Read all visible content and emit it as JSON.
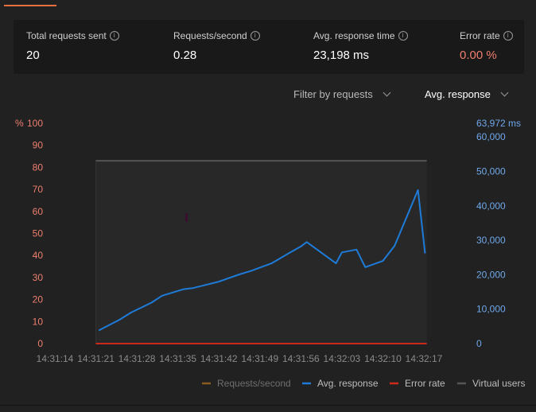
{
  "stats": [
    {
      "label": "Total requests sent",
      "value": "20"
    },
    {
      "label": "Requests/second",
      "value": "0.28"
    },
    {
      "label": "Avg. response time",
      "value": "23,198 ms"
    },
    {
      "label": "Error rate",
      "value": "0.00 %"
    }
  ],
  "colors": {
    "accent": "#e8703e",
    "error_value": "#ef7f6f",
    "left_axis": "#ef7f6f",
    "right_axis": "#6fa8ea",
    "avg_line": "#1e7bd8",
    "error_line": "#cc2a1d",
    "vu_line": "#555555",
    "rps_line": "#8a5a1e"
  },
  "filters": {
    "filter_label": "Filter by requests",
    "metric_label": "Avg. response"
  },
  "chart_data": {
    "type": "line",
    "left_axis": {
      "label": "%",
      "ticks": [
        0,
        10,
        20,
        30,
        40,
        50,
        60,
        70,
        80,
        90,
        100
      ],
      "range": [
        0,
        100
      ]
    },
    "right_axis": {
      "label": "63,972 ms",
      "ticks": [
        "0",
        "10,000",
        "20,000",
        "30,000",
        "40,000",
        "50,000",
        "60,000"
      ],
      "range": [
        0,
        63972
      ]
    },
    "x_ticks": [
      "14:31:14",
      "14:31:21",
      "14:31:28",
      "14:31:35",
      "14:31:42",
      "14:31:49",
      "14:31:56",
      "14:32:03",
      "14:32:10",
      "14:32:17"
    ],
    "x_range": [
      0,
      63
    ],
    "series": [
      {
        "name": "Requests/second",
        "x": [],
        "values": []
      },
      {
        "name": "Avg. response",
        "axis": "right",
        "x": [
          7.5,
          11,
          13,
          16.5,
          18.3,
          22,
          23.5,
          28,
          31.5,
          33.5,
          37,
          40,
          42,
          43,
          48,
          49,
          51.5,
          53,
          56,
          58,
          62,
          63.2
        ],
        "values": [
          3800,
          6900,
          9000,
          11900,
          13900,
          15800,
          16100,
          18000,
          20100,
          21100,
          23300,
          26300,
          28200,
          29500,
          23300,
          26500,
          27300,
          22200,
          24000,
          28400,
          44600,
          26200
        ]
      },
      {
        "name": "Error rate",
        "axis": "left",
        "x": [
          7,
          63.5
        ],
        "values": [
          0,
          0
        ]
      },
      {
        "name": "Virtual users",
        "x": [
          7,
          63.5
        ],
        "values": [
          83,
          83
        ]
      }
    ]
  },
  "legend": [
    {
      "label": "Requests/second",
      "color": "#8a5a1e"
    },
    {
      "label": "Avg. response",
      "color": "#1e7bd8"
    },
    {
      "label": "Error rate",
      "color": "#cc2a1d"
    },
    {
      "label": "Virtual users",
      "color": "#555555"
    }
  ]
}
